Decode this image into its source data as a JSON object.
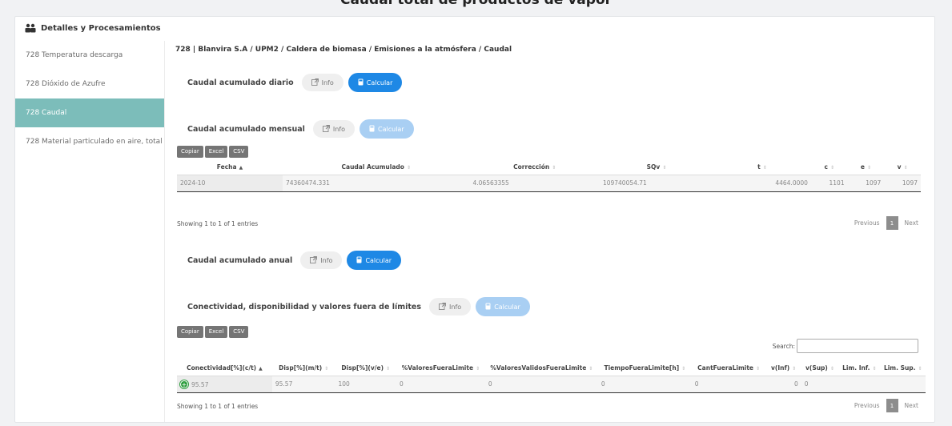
{
  "page_title": "Caudal total de productos de vapor",
  "card": {
    "title": "Detalles y Procesamientos"
  },
  "sidebar": {
    "items": [
      {
        "label": "728 Temperatura descarga"
      },
      {
        "label": "728 Dióxido de Azufre"
      },
      {
        "label": "728 Caudal"
      },
      {
        "label": "728 Material particulado en aire, total"
      }
    ]
  },
  "breadcrumb": "728 | Blanvira S.A / UPM2 / Caldera de biomasa / Emisiones a la atmósfera / Caudal",
  "sections": {
    "diario": {
      "label": "Caudal acumulado diario",
      "info": "Info",
      "calc": "Calcular"
    },
    "mensual": {
      "label": "Caudal acumulado mensual",
      "info": "Info",
      "calc": "Calcular"
    },
    "anual": {
      "label": "Caudal acumulado anual",
      "info": "Info",
      "calc": "Calcular"
    },
    "conect": {
      "label": "Conectividad, disponibilidad y valores fuera de límites",
      "info": "Info",
      "calc": "Calcular"
    }
  },
  "export": {
    "copy": "Copiar",
    "excel": "Excel",
    "csv": "CSV"
  },
  "table1": {
    "headers": [
      "Fecha",
      "Caudal Acumulado",
      "Corrección",
      "SQv",
      "t",
      "c",
      "e",
      "v"
    ],
    "rows": [
      [
        "2024-10",
        "74360474.331",
        "4.06563355",
        "109740054.71",
        "4464.0000",
        "1101",
        "1097",
        "1097"
      ]
    ],
    "info": "Showing 1 to 1 of 1 entries"
  },
  "table2": {
    "headers": [
      "Conectividad[%](c/t)",
      "Disp[%](m/t)",
      "Disp[%](v/e)",
      "%ValoresFueraLimite",
      "%ValoresValidosFueraLimite",
      "TiempoFueraLimite[h]",
      "CantFueraLimite",
      "v(Inf)",
      "v(Sup)",
      "Lim. Inf.",
      "Lim. Sup."
    ],
    "rows": [
      [
        "95.57",
        "95.57",
        "100",
        "0",
        "0",
        "0",
        "0",
        "0",
        "0",
        "",
        ""
      ]
    ],
    "info": "Showing 1 to 1 of 1 entries",
    "search_label": "Search:"
  },
  "pager": {
    "previous": "Previous",
    "page": "1",
    "next": "Next"
  },
  "colors": {
    "active_sidebar": "#7cbdba",
    "primary": "#1e88e5",
    "primary_disabled": "#a9cff3"
  }
}
